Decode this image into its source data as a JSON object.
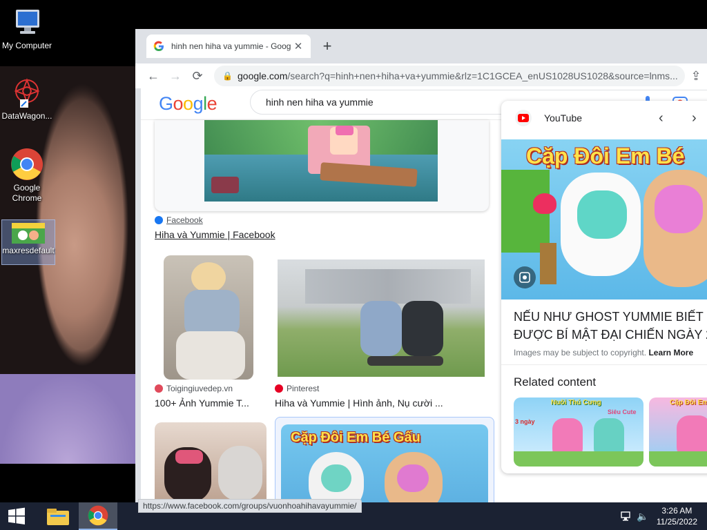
{
  "desktop": {
    "icons": [
      {
        "label": "My Computer"
      },
      {
        "label": "DataWagon..."
      },
      {
        "label": "Google Chrome"
      },
      {
        "label": "maxresdefault"
      }
    ]
  },
  "browser": {
    "tab_title": "hinh nen hiha va yummie - Goog",
    "address": "google.com",
    "address_path": "/search?q=hinh+nen+hiha+va+yummie&rlz=1C1GCEA_enUS1028US1028&source=lnms...",
    "status_url": "https://www.facebook.com/groups/vuonhoahihavayummie/"
  },
  "google": {
    "logo": "Google",
    "query": "hinh nen hiha va yummie"
  },
  "results": {
    "facebook": {
      "source": "Facebook",
      "title": "Hiha và Yummie | Facebook"
    },
    "item2": {
      "source": "Toigingiuvedep.vn",
      "title": "100+ Ảnh Yummie T..."
    },
    "item3": {
      "source": "Pinterest",
      "title": "Hiha và Yummie | Hình ảnh, Nụ cười ..."
    },
    "thumb_banner": "Cặp Đôi Em Bé Gấu"
  },
  "panel": {
    "source": "YouTube",
    "banner": "Cặp Đôi Em Bé",
    "title_line1": "NẾU NHƯ GHOST YUMMIE BIẾT",
    "title_line2": "ĐƯỢC BÍ MẬT ĐẠI CHIẾN NGÀY 2...",
    "copyright": "Images may be subject to copyright.",
    "learn_more": "Learn More",
    "related": "Related content",
    "related1_text": "Nuôi Thú Cưng",
    "related1_sub": "Siêu Cute",
    "related1_days": "3 ngày",
    "related2_text": "Cặp Đôi Em"
  },
  "taskbar": {
    "time": "3:26 AM",
    "date": "11/25/2022"
  },
  "colors": {
    "accent": "#1a73e8",
    "taskbar": "#1b2233",
    "youtube_red": "#ff0000"
  }
}
